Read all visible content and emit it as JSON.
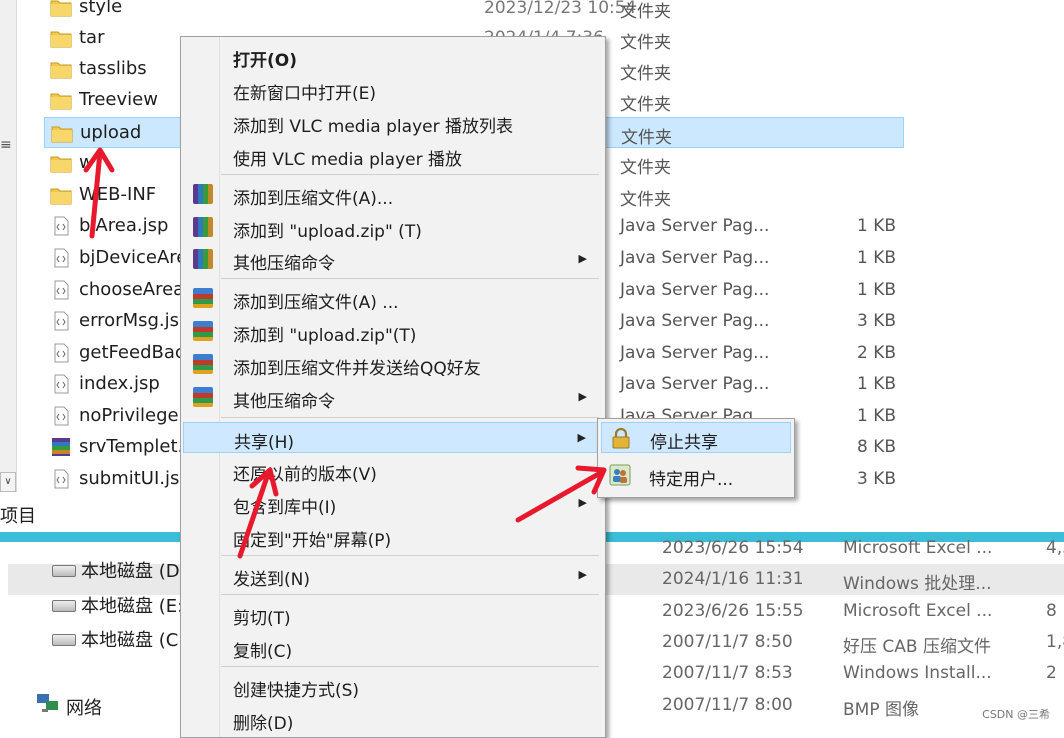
{
  "file_list": {
    "rows": [
      {
        "name": "style",
        "date": "2023/12/23 10:54",
        "type": "文件夹",
        "size": "",
        "icon": "folder-icon"
      },
      {
        "name": "tar",
        "date": "2024/1/4 7:36",
        "type": "文件夹",
        "size": "",
        "icon": "folder-icon"
      },
      {
        "name": "tasslibs",
        "date": "",
        "type": "文件夹",
        "size": "",
        "icon": "folder-icon"
      },
      {
        "name": "Treeview",
        "date": "",
        "type": "文件夹",
        "size": "",
        "icon": "folder-icon"
      },
      {
        "name": "upload",
        "date": "",
        "type": "文件夹",
        "size": "",
        "icon": "folder-icon",
        "selected": true
      },
      {
        "name": "w",
        "date": "",
        "type": "文件夹",
        "size": "",
        "icon": "folder-icon"
      },
      {
        "name": "WEB-INF",
        "date": "",
        "type": "文件夹",
        "size": "",
        "icon": "folder-icon"
      },
      {
        "name": "bjArea.jsp",
        "date": "",
        "type": "Java Server Pag...",
        "size": "1 KB",
        "icon": "jsp-file-icon"
      },
      {
        "name": "bjDeviceAre",
        "date": "",
        "type": "Java Server Pag...",
        "size": "1 KB",
        "icon": "jsp-file-icon"
      },
      {
        "name": "chooseArea",
        "date": "",
        "type": "Java Server Pag...",
        "size": "1 KB",
        "icon": "jsp-file-icon"
      },
      {
        "name": "errorMsg.js",
        "date": "",
        "type": "Java Server Pag...",
        "size": "3 KB",
        "icon": "jsp-file-icon"
      },
      {
        "name": "getFeedBac",
        "date": "",
        "type": "Java Server Pag...",
        "size": "2 KB",
        "icon": "jsp-file-icon"
      },
      {
        "name": "index.jsp",
        "date": "",
        "type": "Java Server Pag...",
        "size": "1 KB",
        "icon": "jsp-file-icon"
      },
      {
        "name": "noPrivilegeE",
        "date": "",
        "type": "Java Server Pag",
        "size": "1 KB",
        "icon": "jsp-file-icon"
      },
      {
        "name": "srvTemplet.",
        "date": "",
        "type": "",
        "size": "8 KB",
        "icon": "archive-icon"
      },
      {
        "name": "submitUI.jsp",
        "date": "",
        "type": "",
        "size": "3 KB",
        "icon": "jsp-file-icon"
      }
    ],
    "status_text": "项目"
  },
  "navigation": {
    "items": [
      {
        "label": "本地磁盘 (D",
        "icon": "drive-icon"
      },
      {
        "label": "本地磁盘 (E:",
        "icon": "drive-icon"
      },
      {
        "label": "本地磁盘 (C",
        "icon": "drive-icon"
      },
      {
        "label": "网络",
        "icon": "network-icon"
      }
    ]
  },
  "lower_list": {
    "rows": [
      {
        "date": "2023/6/26 15:54",
        "type": "Microsoft Excel ...",
        "size": "4,5"
      },
      {
        "date": "2024/1/16 11:31",
        "type": "Windows 批处理...",
        "size": "",
        "highlighted": true
      },
      {
        "date": "2023/6/26 15:55",
        "type": "Microsoft Excel ...",
        "size": "8"
      },
      {
        "date": "2007/11/7 8:50",
        "type": "好压 CAB 压缩文件",
        "size": "1,8"
      },
      {
        "date": "2007/11/7 8:53",
        "type": "Windows Install...",
        "size": "2"
      },
      {
        "date": "2007/11/7 8:00",
        "type": "BMP 图像",
        "size": ""
      }
    ]
  },
  "context_menu": {
    "items": [
      {
        "label": "打开(O)",
        "bold": true
      },
      {
        "label": "在新窗口中打开(E)"
      },
      {
        "label": "添加到 VLC media player 播放列表"
      },
      {
        "label": "使用 VLC media player 播放"
      },
      {
        "label": "添加到压缩文件(A)...",
        "icon": "winrar-icon"
      },
      {
        "label": "添加到 \"upload.zip\" (T)",
        "icon": "winrar-icon"
      },
      {
        "label": "其他压缩命令",
        "icon": "winrar-icon",
        "submenu": true
      },
      {
        "label": "添加到压缩文件(A) ...",
        "icon": "haozip-icon"
      },
      {
        "label": "添加到 \"upload.zip\"(T)",
        "icon": "haozip-icon"
      },
      {
        "label": "添加到压缩文件并发送给QQ好友",
        "icon": "haozip-icon"
      },
      {
        "label": "其他压缩命令",
        "icon": "haozip-icon",
        "submenu": true
      },
      {
        "label": "共享(H)",
        "submenu": true,
        "highlighted": true
      },
      {
        "label": "还原以前的版本(V)"
      },
      {
        "label": "包含到库中(I)",
        "submenu": true
      },
      {
        "label": "固定到\"开始\"屏幕(P)"
      },
      {
        "label": "发送到(N)",
        "submenu": true
      },
      {
        "label": "剪切(T)"
      },
      {
        "label": "复制(C)"
      },
      {
        "label": "创建快捷方式(S)"
      },
      {
        "label": "删除(D)"
      }
    ],
    "submenu_arrow": "▶"
  },
  "share_submenu": {
    "items": [
      {
        "label": "停止共享",
        "icon": "lock-icon",
        "highlighted": true
      },
      {
        "label": "特定用户...",
        "icon": "users-icon"
      }
    ]
  },
  "watermark": "CSDN @三希",
  "colors": {
    "selection_bg": "#cce8ff",
    "selection_border": "#99d1ff",
    "divider": "#3cbcd6",
    "annotation_arrow": "#e8192c"
  }
}
